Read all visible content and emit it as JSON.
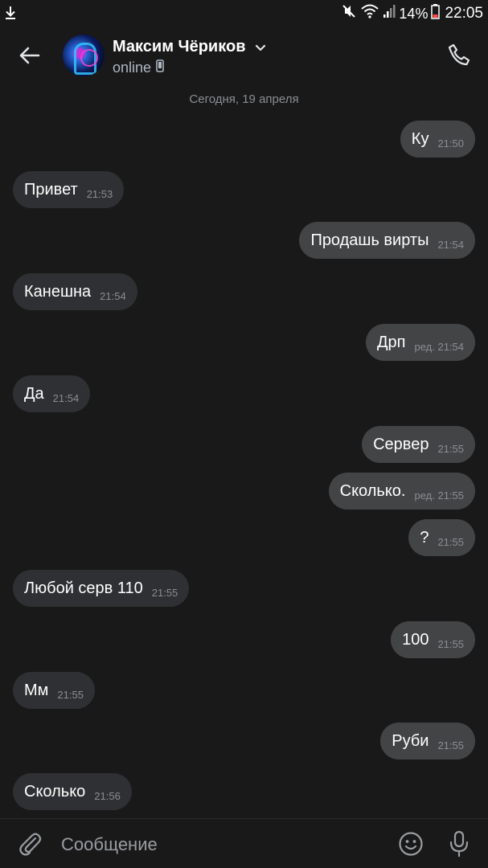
{
  "status_bar": {
    "battery_percent": "14%",
    "time": "22:05",
    "icons": [
      "download-icon",
      "mute-icon",
      "wifi-icon",
      "signal-icon",
      "battery-icon"
    ]
  },
  "header": {
    "contact_name": "Максим Чёриков",
    "status": "online",
    "icons": [
      "back-arrow-icon",
      "chevron-down-icon",
      "phone-device-icon",
      "phone-call-icon"
    ]
  },
  "date_separator": "Сегодня, 19 апреля",
  "messages": [
    {
      "text": "Ку",
      "time": "21:50",
      "edited": false,
      "direction": "out"
    },
    {
      "text": "Привет",
      "time": "21:53",
      "edited": false,
      "direction": "in"
    },
    {
      "text": "Продашь вирты",
      "time": "21:54",
      "edited": false,
      "direction": "out"
    },
    {
      "text": "Канешна",
      "time": "21:54",
      "edited": false,
      "direction": "in"
    },
    {
      "text": "Дрп",
      "time": "ред. 21:54",
      "edited": true,
      "direction": "out"
    },
    {
      "text": "Да",
      "time": "21:54",
      "edited": false,
      "direction": "in"
    },
    {
      "text": "Сервер",
      "time": "21:55",
      "edited": false,
      "direction": "out"
    },
    {
      "text": "Сколько.",
      "time": "ред. 21:55",
      "edited": true,
      "direction": "out"
    },
    {
      "text": "?",
      "time": "21:55",
      "edited": false,
      "direction": "out"
    },
    {
      "text": "Любой серв 110",
      "time": "21:55",
      "edited": false,
      "direction": "in"
    },
    {
      "text": "100",
      "time": "21:55",
      "edited": false,
      "direction": "out"
    },
    {
      "text": "Мм",
      "time": "21:55",
      "edited": false,
      "direction": "in"
    },
    {
      "text": "Руби",
      "time": "21:55",
      "edited": false,
      "direction": "out"
    },
    {
      "text": "Сколько",
      "time": "21:56",
      "edited": false,
      "direction": "in"
    }
  ],
  "composer": {
    "placeholder": "Сообщение",
    "value": "",
    "icons": [
      "paperclip-icon",
      "emoji-icon",
      "microphone-icon"
    ]
  },
  "colors": {
    "background": "#19191a",
    "incoming_bubble": "#2f3033",
    "outgoing_bubble": "#434446",
    "text": "#ffffff",
    "meta_text": "#8a8d91"
  }
}
